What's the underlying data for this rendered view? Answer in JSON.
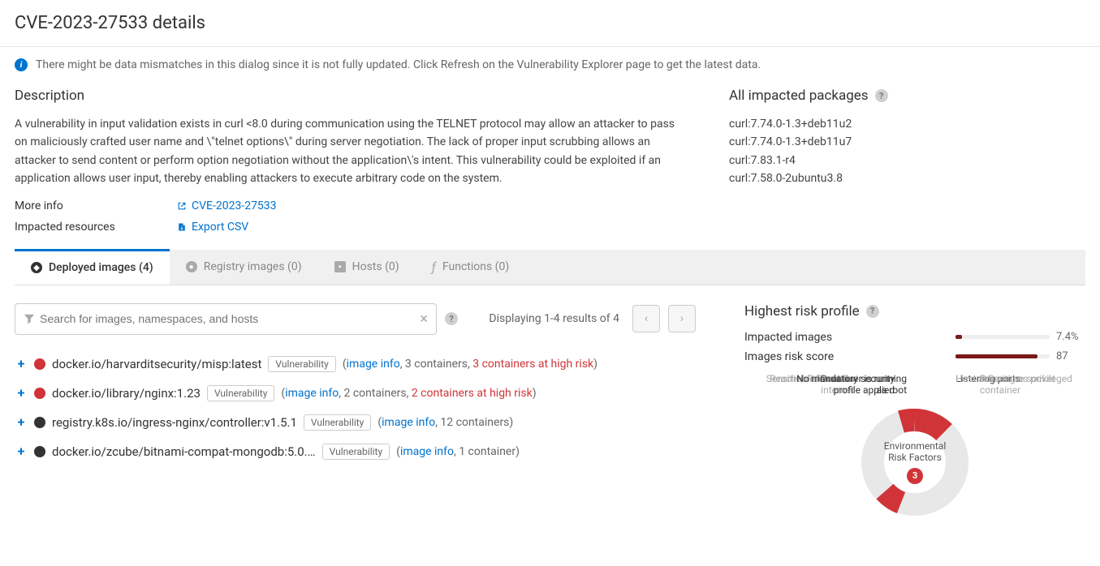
{
  "header": {
    "title": "CVE-2023-27533 details"
  },
  "banner": {
    "text": "There might be data mismatches in this dialog since it is not fully updated. Click Refresh on the Vulnerability Explorer page to get the latest data."
  },
  "description": {
    "heading": "Description",
    "text": "A vulnerability in input validation exists in curl <8.0 during communication using the TELNET protocol may allow an attacker to pass on maliciously crafted user name and \\\"telnet options\\\" during server negotiation. The lack of proper input scrubbing allows an attacker to send content or perform option negotiation without the application\\'s intent. This vulnerability could be exploited if an application allows user input, thereby enabling attackers to execute arbitrary code on the system.",
    "more_info_label": "More info",
    "more_info_link": "CVE-2023-27533",
    "impacted_label": "Impacted resources",
    "export_label": "Export CSV"
  },
  "packages": {
    "heading": "All impacted packages",
    "items": [
      "curl:7.74.0-1.3+deb11u2",
      "curl:7.74.0-1.3+deb11u7",
      "curl:7.83.1-r4",
      "curl:7.58.0-2ubuntu3.8"
    ]
  },
  "tabs": {
    "deployed": "Deployed images (4)",
    "registry": "Registry images (0)",
    "hosts": "Hosts (0)",
    "functions": "Functions (0)"
  },
  "search": {
    "placeholder": "Search for images, namespaces, and hosts",
    "results_text": "Displaying 1-4 results of 4"
  },
  "images": [
    {
      "severity": "red",
      "name": "docker.io/harvarditsecurity/misp:latest",
      "tag": "Vulnerability",
      "image_info": "image info",
      "containers": ", 3 containers, ",
      "risk": "3 containers at high risk"
    },
    {
      "severity": "red",
      "name": "docker.io/library/nginx:1.23",
      "tag": "Vulnerability",
      "image_info": "image info",
      "containers": ", 2 containers, ",
      "risk": "2 containers at high risk"
    },
    {
      "severity": "dark",
      "name": "registry.k8s.io/ingress-nginx/controller:v1.5.1",
      "tag": "Vulnerability",
      "image_info": "image info",
      "containers": ", 12 containers)",
      "risk": ""
    },
    {
      "severity": "dark",
      "name": "docker.io/zcube/bitnami-compat-mongodb:5.0.…",
      "tag": "Vulnerability",
      "image_info": "image info",
      "containers": ", 1 container)",
      "risk": ""
    }
  ],
  "risk_profile": {
    "heading": "Highest risk profile",
    "impacted_label": "Impacted images",
    "impacted_pct": "7.4%",
    "impacted_width": 7,
    "score_label": "Images risk score",
    "score_val": "87",
    "score_width": 87,
    "wheel_center": "Environmental Risk Factors",
    "wheel_count": "3",
    "factors": {
      "root": "Container is running as root",
      "listening": "Listening ports",
      "mount": "Root mount",
      "privileged": "Running as privileged container",
      "internet": "Reachable from the internet",
      "runtime": "Runtime socket",
      "sensitive": "Sensitive information",
      "host": "Host access",
      "security": "No mandatory security profile applied"
    }
  }
}
